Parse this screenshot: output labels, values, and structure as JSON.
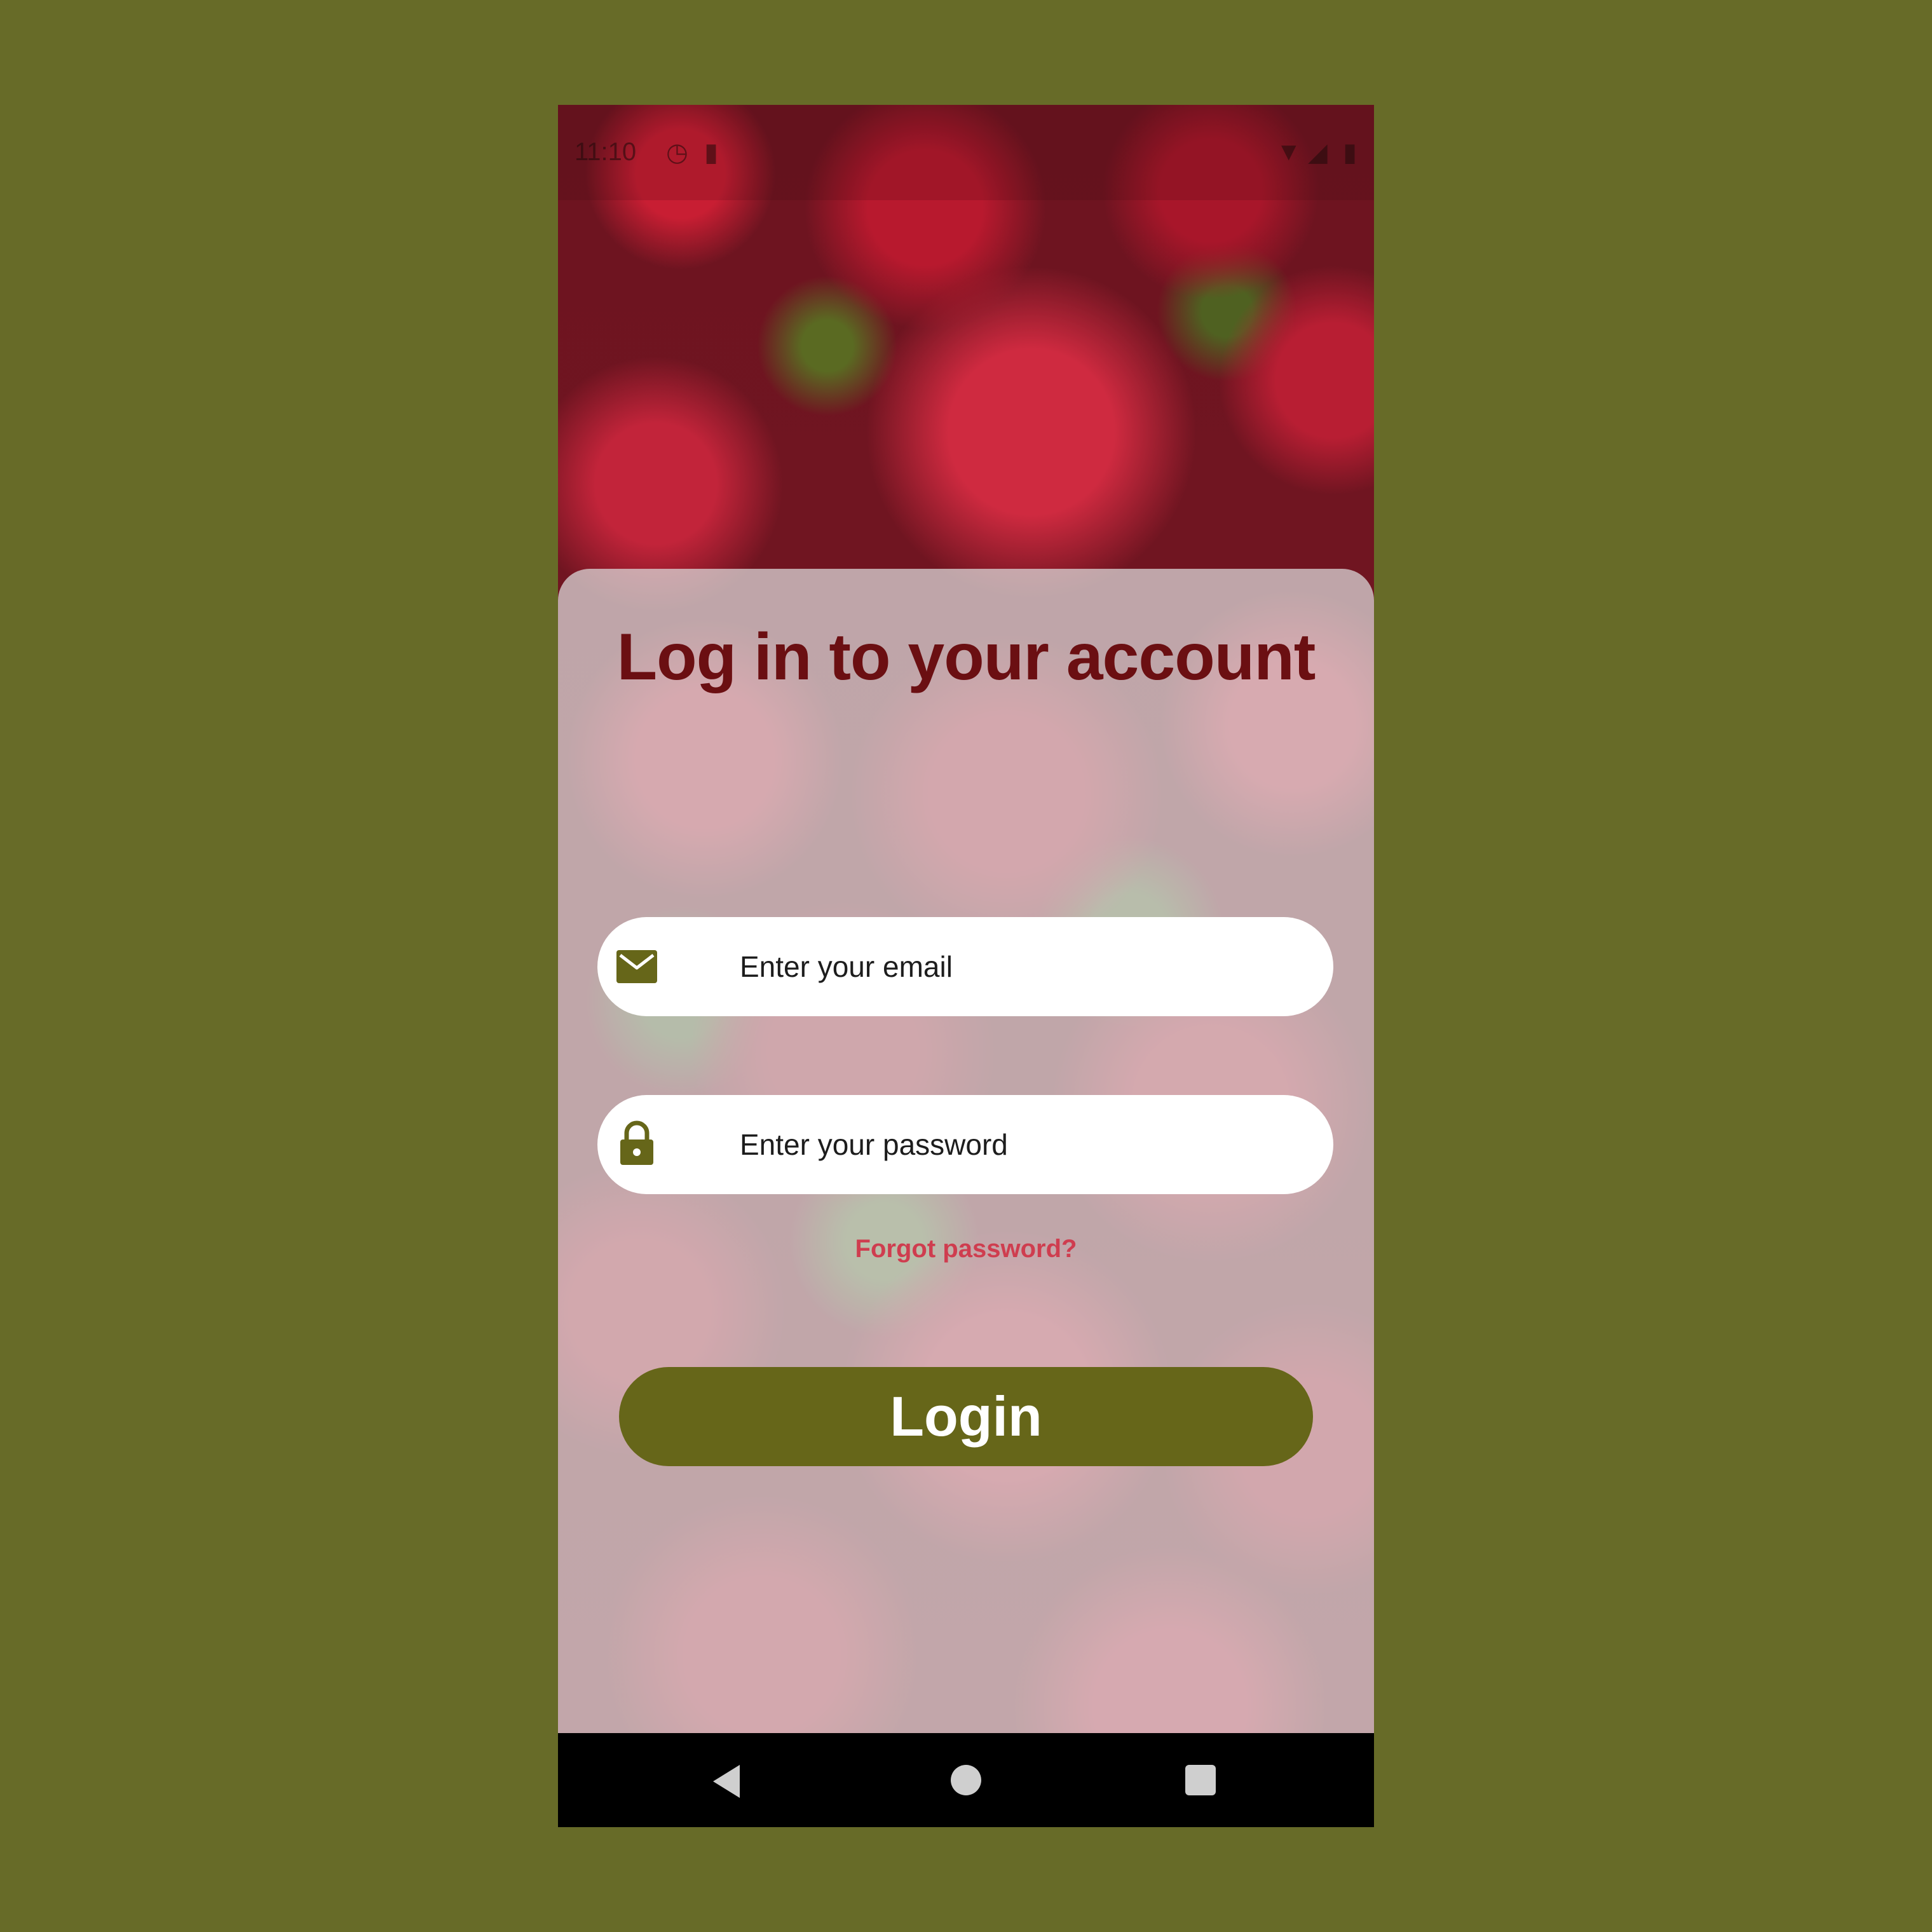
{
  "status_bar": {
    "time": "11:10"
  },
  "login": {
    "title": "Log in to your account",
    "email_placeholder": "Enter your email",
    "password_placeholder": "Enter your password",
    "forgot_password": "Forgot password?",
    "login_button": "Login"
  },
  "icons": {
    "email": "mail-icon",
    "password": "lock-icon",
    "back": "back-icon",
    "home": "home-icon",
    "recents": "recents-icon"
  },
  "colors": {
    "page_background": "#676b28",
    "title": "#6b0f12",
    "accent": "#666619",
    "forgot_link": "#cf3d4f"
  }
}
